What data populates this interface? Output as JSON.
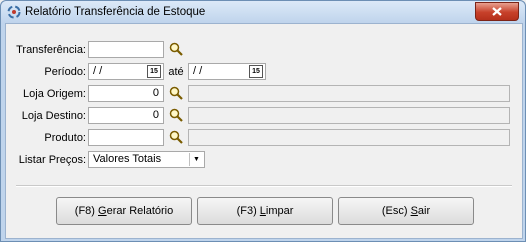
{
  "window": {
    "title": "Relatório Transferência de Estoque"
  },
  "form": {
    "transferencia": {
      "label": "Transferência:",
      "value": ""
    },
    "periodo": {
      "label": "Período:",
      "from": " /  /",
      "sep": "até",
      "to": " /  /",
      "cal": "15"
    },
    "loja_origem": {
      "label": "Loja Origem:",
      "value": "0",
      "desc": ""
    },
    "loja_destino": {
      "label": "Loja Destino:",
      "value": "0",
      "desc": ""
    },
    "produto": {
      "label": "Produto:",
      "value": "",
      "desc": ""
    },
    "listar_precos": {
      "label": "Listar Preços:",
      "value": "Valores Totais"
    }
  },
  "buttons": {
    "gerar": {
      "prefix": "(F8) ",
      "hot": "G",
      "rest": "erar Relatório"
    },
    "limpar": {
      "prefix": "(F3) ",
      "hot": "L",
      "rest": "impar"
    },
    "sair": {
      "prefix": "(Esc) ",
      "hot": "S",
      "rest": "air"
    }
  }
}
